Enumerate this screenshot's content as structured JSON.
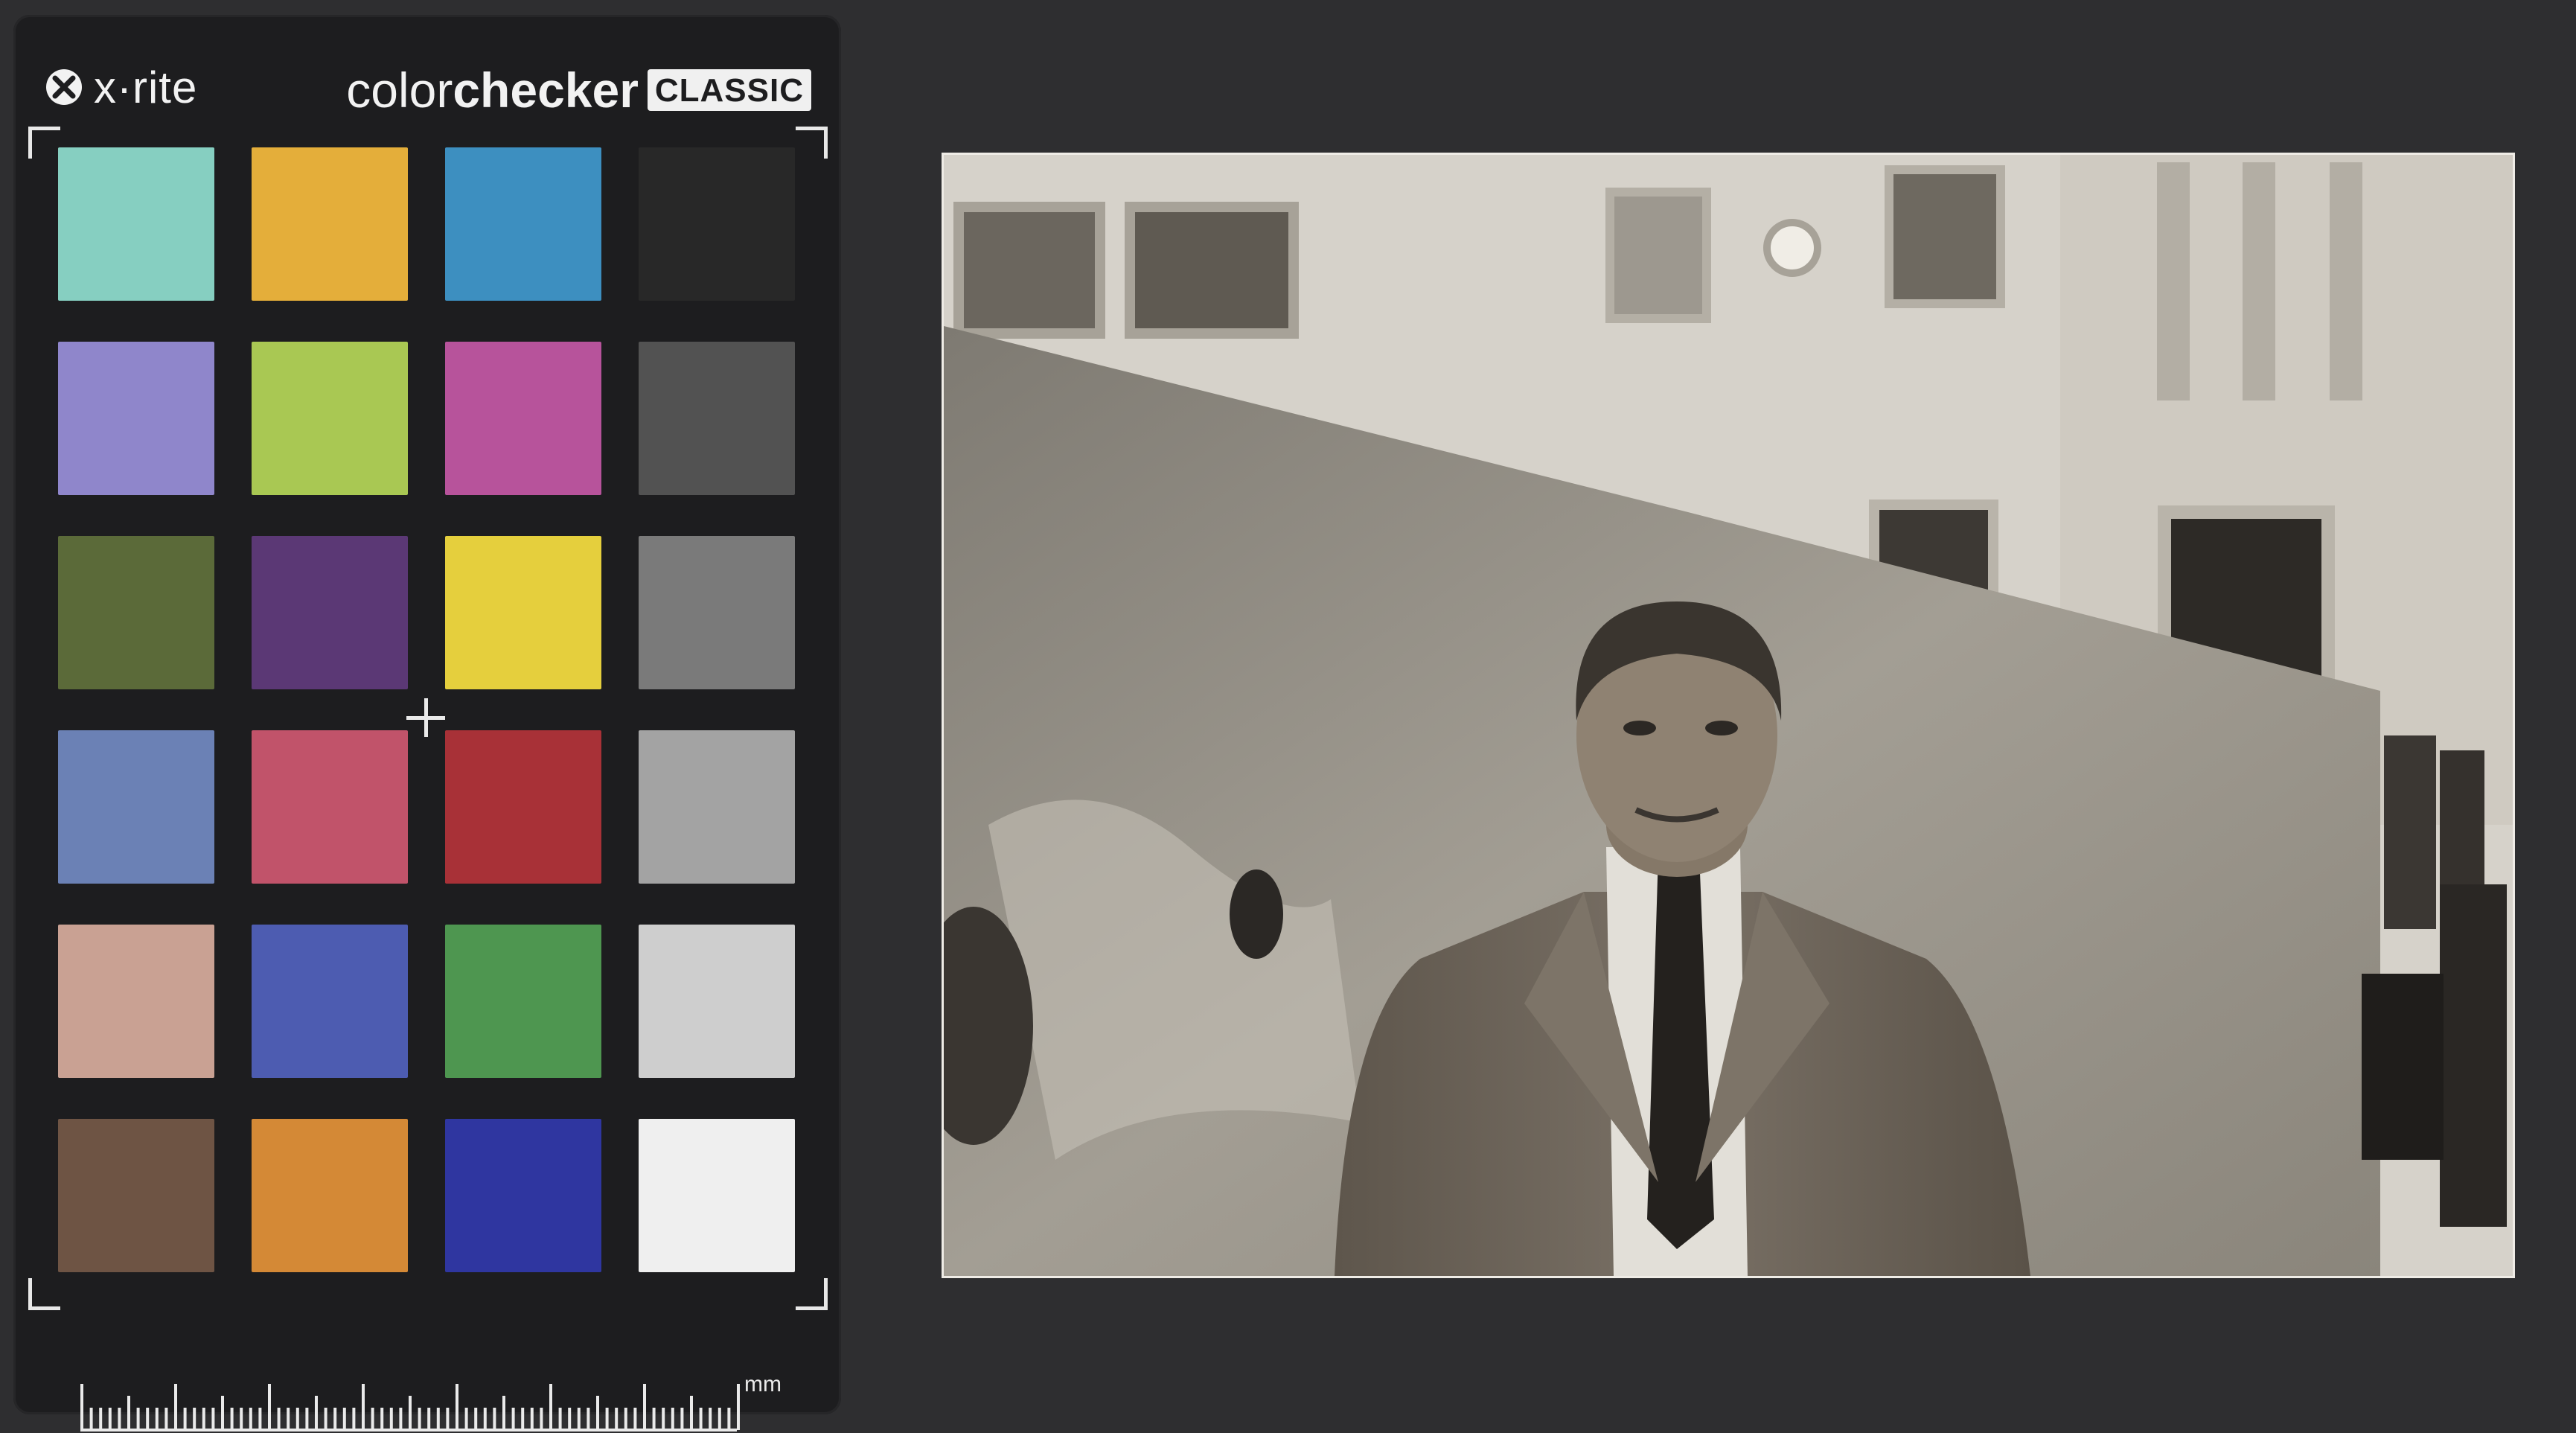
{
  "card": {
    "brand": "x·rite",
    "product_light": "color",
    "product_bold": "checker",
    "edition": "CLASSIC",
    "ruler_unit": "mm",
    "patches": [
      {
        "name": "patch-aqua",
        "color": "#86cfc1"
      },
      {
        "name": "patch-orange-yellow",
        "color": "#e4ae3a"
      },
      {
        "name": "patch-cyan",
        "color": "#3d8fc0"
      },
      {
        "name": "patch-black",
        "color": "#282828"
      },
      {
        "name": "patch-purple-blue",
        "color": "#8f86cb"
      },
      {
        "name": "patch-yellow-green",
        "color": "#a9c853"
      },
      {
        "name": "patch-magenta",
        "color": "#b7539b"
      },
      {
        "name": "patch-neutral-35",
        "color": "#525252"
      },
      {
        "name": "patch-foliage",
        "color": "#5b6a39"
      },
      {
        "name": "patch-purple",
        "color": "#5b3875"
      },
      {
        "name": "patch-yellow",
        "color": "#e5cf3d"
      },
      {
        "name": "patch-neutral-5",
        "color": "#7a7a7a"
      },
      {
        "name": "patch-blue-sky",
        "color": "#6b81b5"
      },
      {
        "name": "patch-moderate-red",
        "color": "#c1536a"
      },
      {
        "name": "patch-red",
        "color": "#a83137"
      },
      {
        "name": "patch-neutral-65",
        "color": "#a3a3a3"
      },
      {
        "name": "patch-light-skin",
        "color": "#c9a193"
      },
      {
        "name": "patch-blue",
        "color": "#4d5cb1"
      },
      {
        "name": "patch-green",
        "color": "#4e9650"
      },
      {
        "name": "patch-neutral-8",
        "color": "#cecece"
      },
      {
        "name": "patch-dark-skin",
        "color": "#6e5444"
      },
      {
        "name": "patch-orange",
        "color": "#d48936"
      },
      {
        "name": "patch-blue-primary",
        "color": "#2f36a0"
      },
      {
        "name": "patch-white",
        "color": "#efefef"
      }
    ]
  },
  "photo": {
    "palette": {
      "sky": "#dcd9d2",
      "building": "#d3cfc7",
      "wall": "#9a958b",
      "suit": "#6a6257",
      "shirt": "#dedbd4",
      "skin": "#8c7f70",
      "hair": "#3a352f",
      "dark": "#2a2724"
    }
  }
}
